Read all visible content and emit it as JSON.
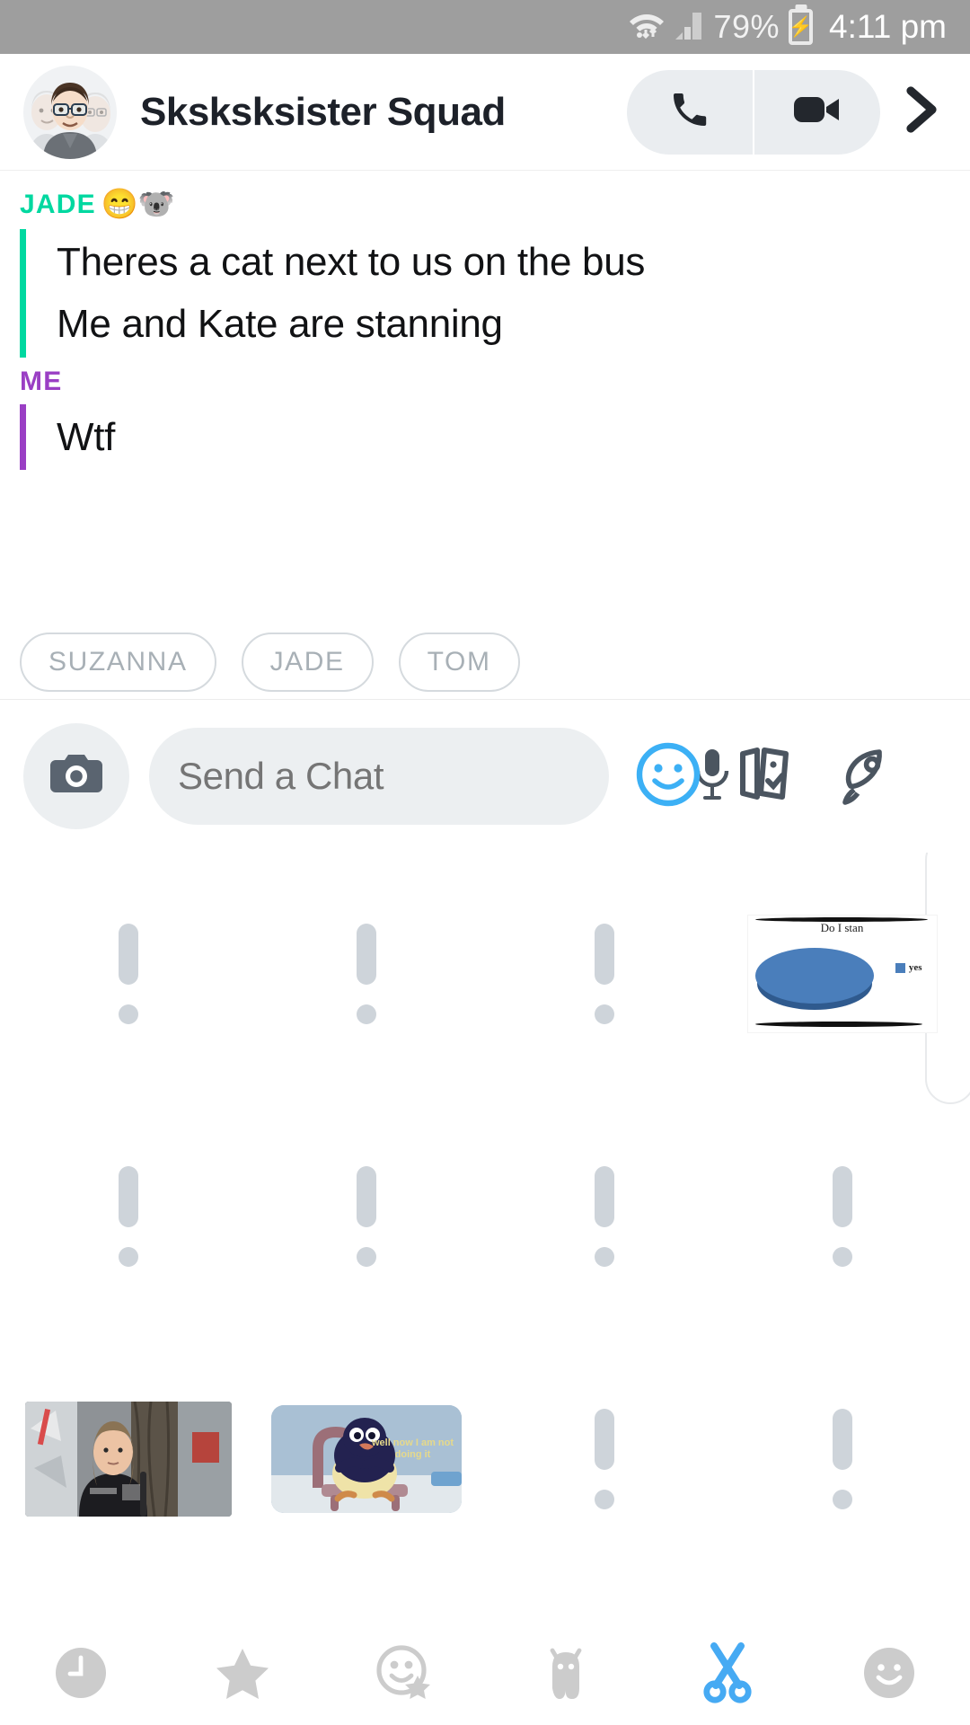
{
  "status_bar": {
    "wifi_icon": "wifi-icon",
    "signal_icon": "cellular-signal-icon",
    "battery_percent": "79%",
    "battery_icon": "battery-charging-icon",
    "time": "4:11 pm"
  },
  "header": {
    "avatar_name": "group-bitmoji-avatar",
    "title": "Sksksksister Squad",
    "call_icon": "phone-icon",
    "video_icon": "video-camera-icon",
    "chevron_icon": "chevron-right-icon"
  },
  "conversation": [
    {
      "sender": "JADE",
      "sender_color": "#00d8a0",
      "emojis": "😁🐨",
      "lines": [
        "Theres a cat next to us on the bus",
        "Me and Kate are stanning"
      ]
    },
    {
      "sender": "ME",
      "sender_color": "#9a3fc4",
      "emojis": "",
      "lines": [
        "Wtf"
      ]
    }
  ],
  "name_chips": [
    "SUZANNA",
    "JADE",
    "TOM"
  ],
  "input_bar": {
    "camera_icon": "camera-icon",
    "placeholder": "Send a Chat",
    "mic_icon": "microphone-icon",
    "sticker_icon": "smiley-sticker-icon",
    "cards_icon": "cards-icon",
    "rocket_icon": "rocket-icon"
  },
  "sticker_panel": {
    "placeholder_icon": "exclamation-placeholder-icon",
    "pie_meme": {
      "title": "Do I stan",
      "legend_label": "yes"
    },
    "thumbnails": [
      {
        "name": "greta-thumbnail",
        "caption": ""
      },
      {
        "name": "pingu-thumbnail",
        "caption": "well now I am not doing it"
      }
    ]
  },
  "tab_bar": [
    {
      "name": "tab-recent",
      "icon": "clock-icon",
      "active": false
    },
    {
      "name": "tab-favorites",
      "icon": "star-icon",
      "active": false
    },
    {
      "name": "tab-bitmoji",
      "icon": "smiley-star-icon",
      "active": false
    },
    {
      "name": "tab-ghost",
      "icon": "ghost-character-icon",
      "active": false
    },
    {
      "name": "tab-cutouts",
      "icon": "scissors-icon",
      "active": true
    },
    {
      "name": "tab-emoji",
      "icon": "smiley-face-icon",
      "active": false
    }
  ],
  "chart_data": {
    "type": "pie",
    "title": "Do I stan",
    "categories": [
      "yes"
    ],
    "values": [
      100
    ],
    "legend": [
      "yes"
    ],
    "legend_position": "right",
    "colors": [
      "#4a7ebb"
    ]
  },
  "colors": {
    "statusbar_bg": "#9e9e9e",
    "jade_accent": "#00d8a0",
    "me_accent": "#9a3fc4",
    "active_blue": "#46aaf3",
    "field_bg": "#eceff1"
  }
}
